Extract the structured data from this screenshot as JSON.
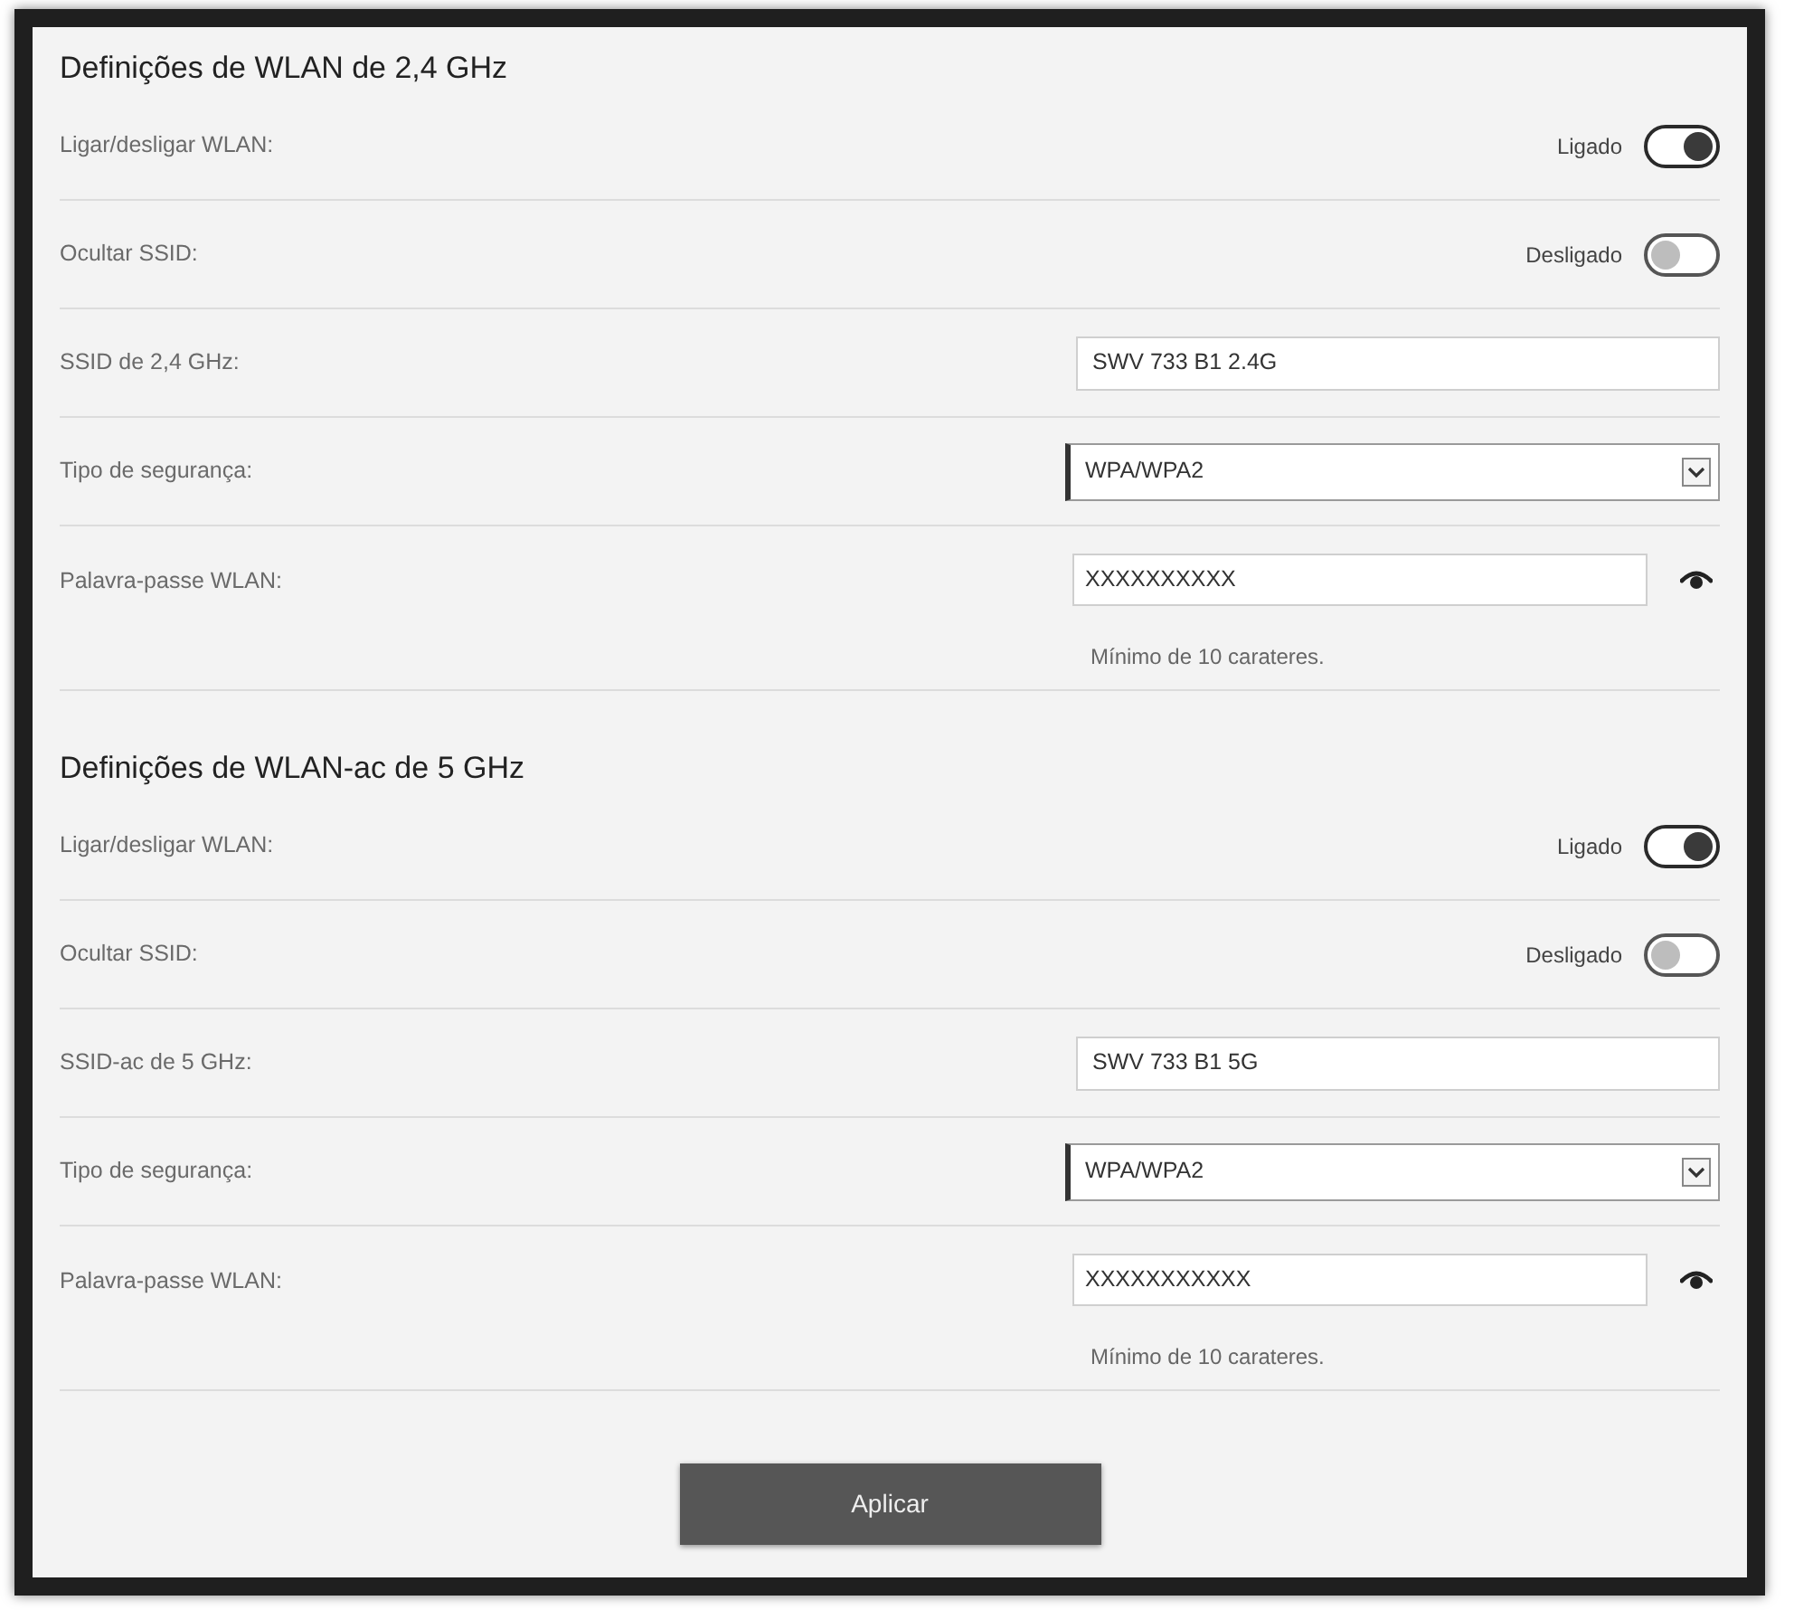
{
  "sections": [
    {
      "title": "Definições de WLAN de 2,4 GHz",
      "rows": [
        {
          "kind": "toggle",
          "label": "Ligar/desligar WLAN:",
          "state_label": "Ligado",
          "on": true
        },
        {
          "kind": "toggle",
          "label": "Ocultar SSID:",
          "state_label": "Desligado",
          "on": false
        },
        {
          "kind": "text",
          "label": "SSID de 2,4 GHz:",
          "value": "SWV 733 B1 2.4G"
        },
        {
          "kind": "select",
          "label": "Tipo de segurança:",
          "value": "WPA/WPA2"
        },
        {
          "kind": "password",
          "label": "Palavra-passe WLAN:",
          "value": "XXXXXXXXXX",
          "hint": "Mínimo de 10 carateres."
        }
      ]
    },
    {
      "title": "Definições de WLAN-ac de 5 GHz",
      "rows": [
        {
          "kind": "toggle",
          "label": "Ligar/desligar WLAN:",
          "state_label": "Ligado",
          "on": true
        },
        {
          "kind": "toggle",
          "label": "Ocultar SSID:",
          "state_label": "Desligado",
          "on": false
        },
        {
          "kind": "text",
          "label": "SSID-ac de 5 GHz:",
          "value": "SWV 733 B1 5G"
        },
        {
          "kind": "select",
          "label": "Tipo de segurança:",
          "value": "WPA/WPA2"
        },
        {
          "kind": "password",
          "label": "Palavra-passe WLAN:",
          "value": "XXXXXXXXXXX",
          "hint": "Mínimo de 10 carateres."
        }
      ]
    }
  ],
  "buttons": [
    {
      "label": "Aplicar"
    }
  ]
}
